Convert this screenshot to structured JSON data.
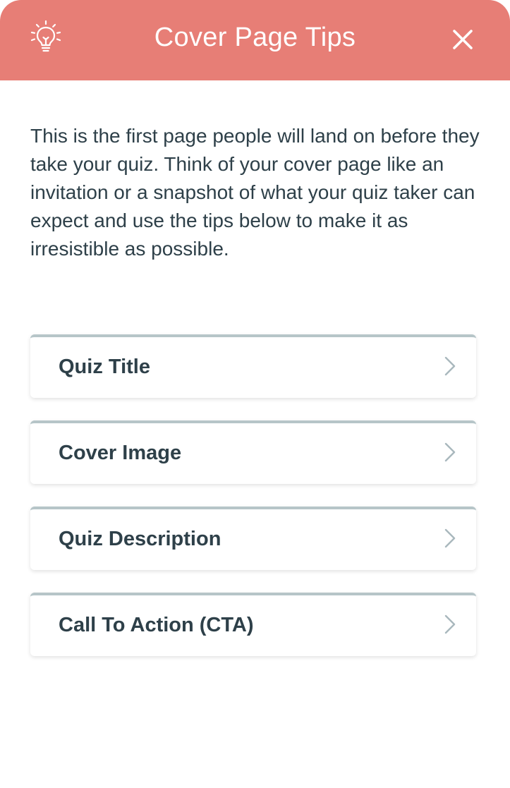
{
  "header": {
    "title": "Cover Page Tips",
    "icon": "lightbulb-icon",
    "close_icon": "close-icon",
    "background_color": "#e77e76"
  },
  "intro": {
    "text": "This is the first page people will land on before they take your quiz. Think of your cover page like an invitation or a snapshot of what your quiz taker can expect and use the tips below to make it as irresistible as possible."
  },
  "tips": {
    "items": [
      {
        "label": "Quiz Title",
        "icon": "chevron-right-icon"
      },
      {
        "label": "Cover Image",
        "icon": "chevron-right-icon"
      },
      {
        "label": "Quiz Description",
        "icon": "chevron-right-icon"
      },
      {
        "label": "Call To Action (CTA)",
        "icon": "chevron-right-icon"
      }
    ]
  }
}
